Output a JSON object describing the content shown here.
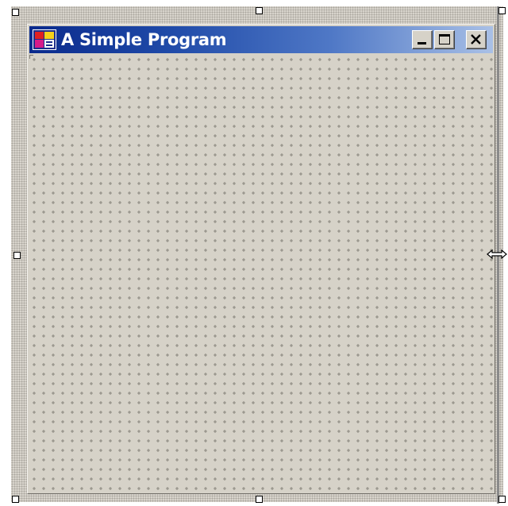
{
  "window": {
    "title": "A Simple Program"
  },
  "icons": {
    "app": "form-app-icon",
    "minimize": "minimize-icon",
    "maximize": "maximize-icon",
    "close": "close-icon",
    "resize_cursor": "horizontal-resize-cursor-icon"
  },
  "colors": {
    "title_bar_start": "#0a2a8c",
    "title_bar_end": "#a9c0e6",
    "form_background": "#d6d2c8",
    "grid_dot": "#7a776f"
  }
}
